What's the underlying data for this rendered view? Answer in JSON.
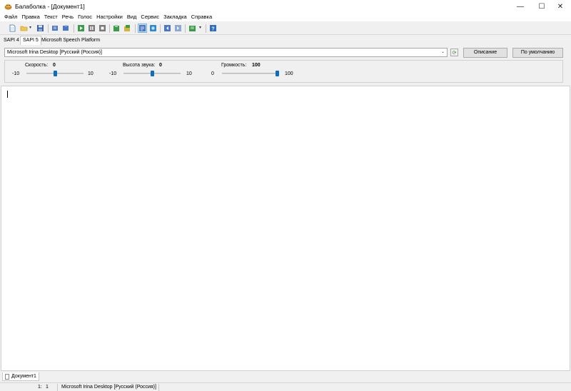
{
  "window": {
    "title": "Балаболка - [Документ1]",
    "minimize_glyph": "—",
    "maximize_glyph": "☐",
    "close_glyph": "✕"
  },
  "menu": [
    "Файл",
    "Правка",
    "Текст",
    "Речь",
    "Голос",
    "Настройки",
    "Вид",
    "Сервис",
    "Закладка",
    "Справка"
  ],
  "toolbar": {
    "icons": [
      "new-document-icon",
      "open-folder-icon",
      "save-icon",
      "read-aloud-icon",
      "read-clipboard-icon",
      "play-icon",
      "pause-icon",
      "stop-icon",
      "save-audio-icon",
      "split-audio-icon",
      "text-view-icon",
      "bookmark-icon",
      "previous-icon",
      "next-icon",
      "dictionary-icon",
      "help-icon"
    ],
    "dropdown_glyph": "▾"
  },
  "tabs": [
    "SAPI 4",
    "SAPI 5",
    "Microsoft Speech Platform"
  ],
  "active_tab": "SAPI 5",
  "voice": {
    "selected": "Microsoft Irina Desktop [Русский (Россия)]",
    "arrow": "⌄",
    "refresh_glyph": "⟳"
  },
  "buttons": {
    "description": "Описание",
    "default": "По умолчанию"
  },
  "sliders": {
    "rate": {
      "label": "Скорость:",
      "value": "0",
      "min": "-10",
      "max": "10",
      "fraction": 0.5
    },
    "pitch": {
      "label": "Высота звука:",
      "value": "0",
      "min": "-10",
      "max": "10",
      "fraction": 0.5
    },
    "volume": {
      "label": "Громкость:",
      "value": "100",
      "min": "0",
      "max": "100",
      "fraction": 1.0
    }
  },
  "document_tab": "Документ1",
  "status": {
    "line": "1:",
    "col": "1",
    "voice": "Microsoft Irina Desktop [Русский (Россия)]"
  },
  "colors": {
    "accent": "#0f6cbd"
  }
}
